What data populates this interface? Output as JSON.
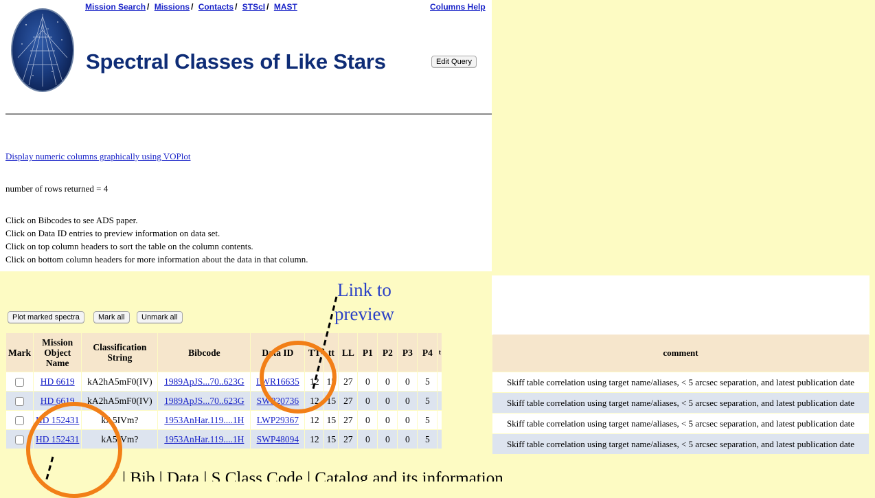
{
  "nav": {
    "mission_search": "Mission Search",
    "missions": "Missions",
    "contacts": "Contacts",
    "stsci": "STScI",
    "mast": "MAST",
    "sep": "/",
    "columns_help": "Columns Help"
  },
  "title": "Spectral Classes of Like Stars",
  "edit_query": "Edit Query",
  "vo_link": "Display numeric columns graphically using VOPlot",
  "rows_returned": "number of rows returned = 4",
  "instructions": [
    "Click on Bibcodes to see ADS paper.",
    "Click on Data ID entries to preview information on data set.",
    "Click on top column headers to sort the table on the column contents.",
    "Click on bottom column headers for more information about the data in that column."
  ],
  "buttons": {
    "plot": "Plot marked spectra",
    "mark_all": "Mark all",
    "unmark_all": "Unmark all"
  },
  "table": {
    "headers": [
      "Mark",
      "Mission Object Name",
      "Classification String",
      "Bibcode",
      "Data ID",
      "TT",
      "tt",
      "LL",
      "P1",
      "P2",
      "P3",
      "P4"
    ],
    "truncated_header": "t",
    "rows": [
      {
        "object": "HD 6619",
        "class": "kA2hA5mF0(IV)",
        "bibcode": "1989ApJS...70..623G",
        "data_id": "LWR16635",
        "TT": "12",
        "tt": "15",
        "LL": "27",
        "P1": "0",
        "P2": "0",
        "P3": "0",
        "P4": "5"
      },
      {
        "object": "HD 6619",
        "class": "kA2hA5mF0(IV)",
        "bibcode": "1989ApJS...70..623G",
        "data_id": "SWP20736",
        "TT": "12",
        "tt": "15",
        "LL": "27",
        "P1": "0",
        "P2": "0",
        "P3": "0",
        "P4": "5"
      },
      {
        "object": "HD 152431",
        "class": "kA5IVm?",
        "bibcode": "1953AnHar.119....1H",
        "data_id": "LWP29367",
        "TT": "12",
        "tt": "15",
        "LL": "27",
        "P1": "0",
        "P2": "0",
        "P3": "0",
        "P4": "5"
      },
      {
        "object": "HD 152431",
        "class": "kA5IVm?",
        "bibcode": "1953AnHar.119....1H",
        "data_id": "SWP48094",
        "TT": "12",
        "tt": "15",
        "LL": "27",
        "P1": "0",
        "P2": "0",
        "P3": "0",
        "P4": "5"
      }
    ]
  },
  "comment_table": {
    "header": "comment",
    "rows": [
      "Skiff table correlation using target name/aliases, < 5 arcsec separation, and latest publication date",
      "Skiff table correlation using target name/aliases, < 5 arcsec separation, and latest publication date",
      "Skiff table correlation using target name/aliases, < 5 arcsec separation, and latest publication date",
      "Skiff table correlation using target name/aliases, < 5 arcsec separation, and latest publication date"
    ]
  },
  "annotations": {
    "callout_line1": "Link to",
    "callout_line2": "preview",
    "bottom_text": "| Bib | Data | S Class Code | Catalog and its information",
    "accent_color": "#f27f17",
    "callout_color": "#2a40c6"
  }
}
